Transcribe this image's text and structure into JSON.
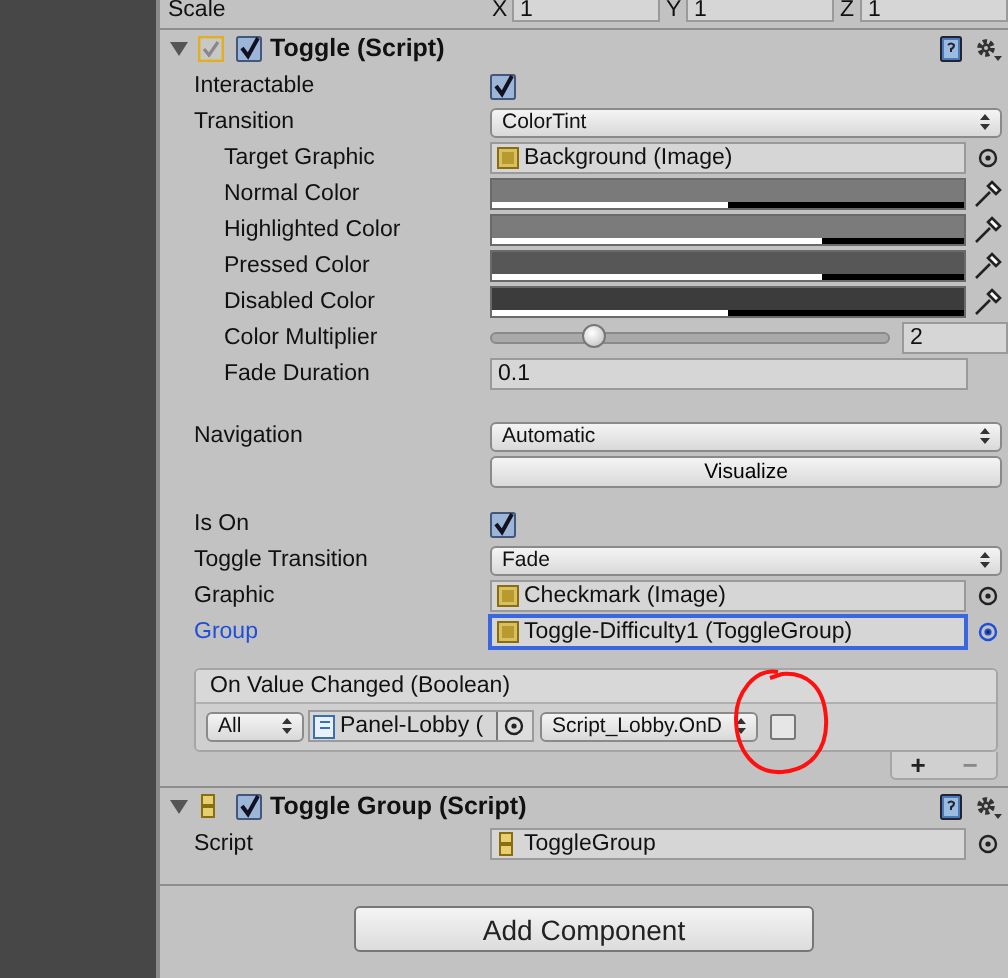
{
  "scale": {
    "label": "Scale",
    "axes": [
      {
        "axis": "X",
        "value": "1"
      },
      {
        "axis": "Y",
        "value": "1"
      },
      {
        "axis": "Z",
        "value": "1"
      }
    ]
  },
  "toggle_component": {
    "title": "Toggle (Script)",
    "expanded": true,
    "enabled": true,
    "sections": [
      [
        {
          "kind": "checkbox",
          "label": "Interactable",
          "checked": true
        },
        {
          "kind": "dropdown",
          "label": "Transition",
          "value": "ColorTint",
          "children": [
            {
              "kind": "object",
              "label": "Target Graphic",
              "value": "Background (Image)",
              "focused": false
            },
            {
              "kind": "color",
              "label": "Normal Color",
              "color": "#7a7a7a",
              "level": 0.5
            },
            {
              "kind": "color",
              "label": "Highlighted Color",
              "color": "#7b7b7b",
              "level": 0.7
            },
            {
              "kind": "color",
              "label": "Pressed Color",
              "color": "#575757",
              "level": 0.7
            },
            {
              "kind": "color",
              "label": "Disabled Color",
              "color": "#3c3c3c",
              "level": 0.5
            },
            {
              "kind": "slider",
              "label": "Color Multiplier",
              "level": 0.26,
              "value": "2"
            },
            {
              "kind": "number",
              "label": "Fade Duration",
              "value": "0.1"
            }
          ]
        }
      ],
      [
        {
          "kind": "dropdown",
          "label": "Navigation",
          "value": "Automatic"
        },
        {
          "kind": "button",
          "label": "Visualize"
        }
      ],
      [
        {
          "kind": "checkbox",
          "label": "Is On",
          "checked": true
        },
        {
          "kind": "dropdown",
          "label": "Toggle Transition",
          "value": "Fade"
        },
        {
          "kind": "object",
          "label": "Graphic",
          "value": "Checkmark (Image)",
          "focused": false
        },
        {
          "kind": "object",
          "label": "Group",
          "value": "Toggle-Difficulty1 (ToggleGroup)",
          "focused": true
        }
      ]
    ],
    "event": {
      "title": "On Value Changed (Boolean)",
      "listeners": [
        {
          "runtime": "All",
          "target": "Panel-Lobby (",
          "function": "Script_Lobby.OnD",
          "argument_checked": false
        }
      ],
      "add": "+",
      "remove": "−"
    }
  },
  "toggle_group_component": {
    "title": "Toggle Group (Script)",
    "expanded": true,
    "enabled": true,
    "script_label": "Script",
    "script": "ToggleGroup"
  },
  "add_component_button": "Add Component"
}
